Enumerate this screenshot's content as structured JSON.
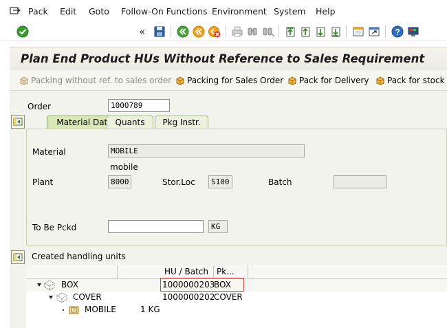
{
  "menu": {
    "items": [
      {
        "label": "Pack",
        "key": "P"
      },
      {
        "label": "Edit",
        "key": "E"
      },
      {
        "label": "Goto",
        "key": "G"
      },
      {
        "label": "Follow-On Functions",
        "key": "F"
      },
      {
        "label": "Environment",
        "key": "n"
      },
      {
        "label": "System",
        "key": "S"
      },
      {
        "label": "Help",
        "key": "H"
      }
    ]
  },
  "toolbar": {
    "command_value": "",
    "icons": [
      "enter-check-icon",
      "back-double-icon",
      "save-icon",
      "back-icon",
      "exit-icon",
      "cancel-icon",
      "print-icon",
      "find-icon",
      "find-next-icon",
      "first-page-icon",
      "previous-page-icon",
      "next-page-icon",
      "last-page-icon",
      "create-session-icon",
      "shortcut-icon",
      "help-icon",
      "customize-layout-icon"
    ]
  },
  "title": "Plan End Product HUs Without Reference to Sales Requirement",
  "appbar": {
    "buttons": [
      {
        "label": "Packing without ref. to sales order",
        "enabled": false
      },
      {
        "label": "Packing for Sales Order",
        "enabled": true
      },
      {
        "label": "Pack for Delivery",
        "enabled": true
      },
      {
        "label": "Pack for stock t",
        "enabled": true
      }
    ]
  },
  "order": {
    "label": "Order",
    "value": "1000789"
  },
  "tabs": [
    {
      "label": "Material Data",
      "active": true
    },
    {
      "label": "Quants",
      "active": false
    },
    {
      "label": "Pkg Instr.",
      "active": false
    }
  ],
  "material": {
    "label": "Material",
    "value": "MOBILE",
    "description": "mobile",
    "plant_label": "Plant",
    "plant_value": "8000",
    "storloc_label": "Stor.Loc",
    "storloc_value": "S100",
    "batch_label": "Batch",
    "batch_value": "",
    "tobepckd_label": "To Be Pckd",
    "tobepckd_value": "",
    "unit_value": "KG"
  },
  "handling_units": {
    "label": "Created handling units",
    "columns": [
      "",
      "HU / Batch",
      "Pk..."
    ],
    "rows": [
      {
        "name": "BOX",
        "qty": "",
        "hu": "1000000203",
        "pk": "BOX",
        "level": 0,
        "expanded": true
      },
      {
        "name": "COVER",
        "qty": "",
        "hu": "1000000202",
        "pk": "COVER",
        "level": 1,
        "expanded": true
      },
      {
        "name": "MOBILE",
        "qty": "1 KG",
        "hu": "",
        "pk": "",
        "level": 2,
        "expanded": false
      }
    ]
  },
  "colors": {
    "title_bg": "#f4f4ee",
    "panel_bg": "#f3f3ee",
    "tab_active": "#d9e6b8",
    "selection_red": "#cc4444"
  }
}
